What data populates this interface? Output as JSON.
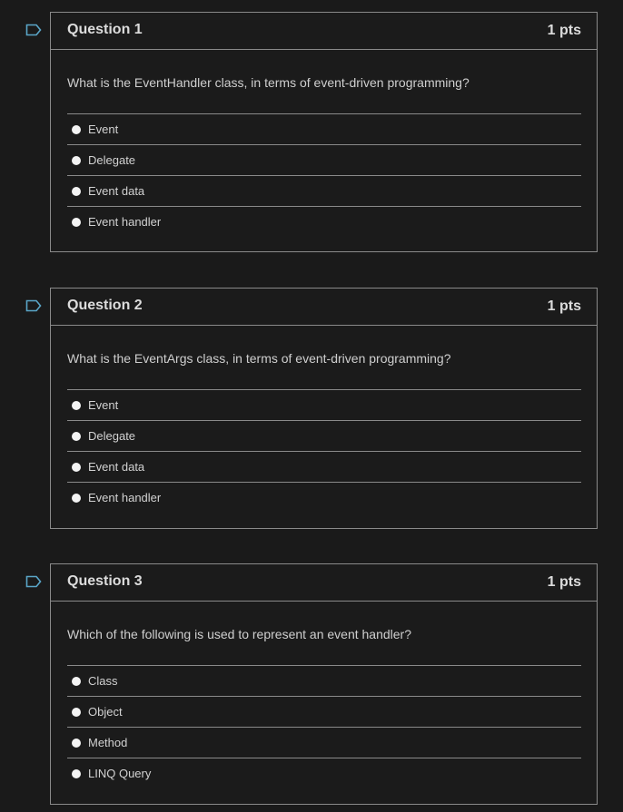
{
  "questions": [
    {
      "title": "Question 1",
      "points": "1 pts",
      "prompt": "What is the EventHandler class, in terms of event-driven programming?",
      "answers": [
        "Event",
        "Delegate",
        "Event data",
        "Event handler"
      ]
    },
    {
      "title": "Question 2",
      "points": "1 pts",
      "prompt": "What is the EventArgs class, in terms of event-driven programming?",
      "answers": [
        "Event",
        "Delegate",
        "Event data",
        "Event handler"
      ]
    },
    {
      "title": "Question 3",
      "points": "1 pts",
      "prompt": "Which of the following is used to represent an event handler?",
      "answers": [
        "Class",
        "Object",
        "Method",
        "LINQ Query"
      ]
    }
  ],
  "colors": {
    "background": "#1a1a1a",
    "border": "#8a8a8a",
    "flag": "#5aa6c8",
    "text": "#d6d6d6"
  },
  "icons": {
    "flag": "bookmark-flag-icon",
    "radio": "radio-button-icon"
  }
}
